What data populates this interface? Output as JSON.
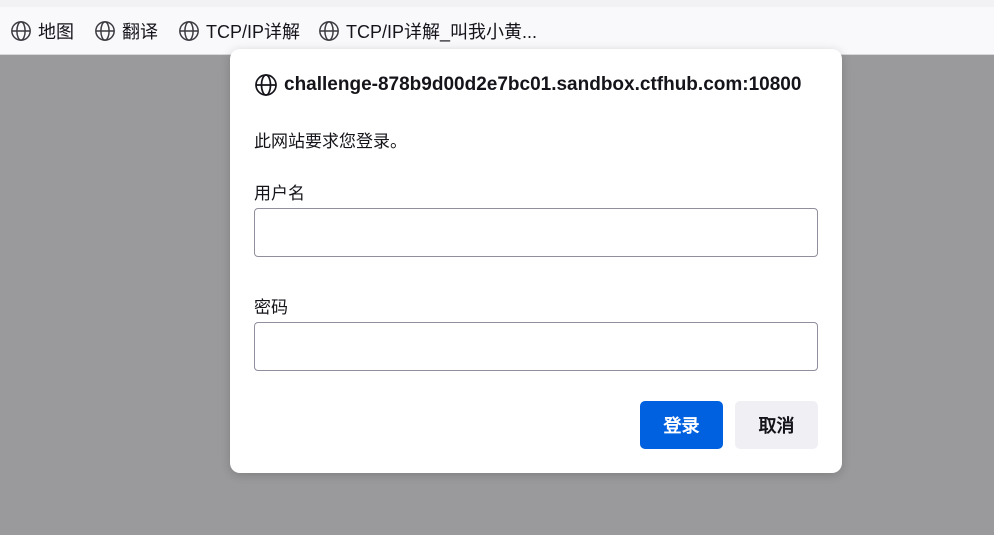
{
  "bookmarks": [
    {
      "label": "地图",
      "icon": "globe-icon"
    },
    {
      "label": "翻译",
      "icon": "globe-icon"
    },
    {
      "label": "TCP/IP详解",
      "icon": "globe-icon"
    },
    {
      "label": "TCP/IP详解_叫我小黄...",
      "icon": "globe-icon"
    }
  ],
  "dialog": {
    "host": "challenge-878b9d00d2e7bc01.sandbox.ctfhub.com:10800",
    "host_icon": "globe-icon",
    "message": "此网站要求您登录。",
    "username_label": "用户名",
    "username_value": "",
    "password_label": "密码",
    "password_value": "",
    "login_button": "登录",
    "cancel_button": "取消"
  },
  "colors": {
    "primary": "#0061e0",
    "overlay": "#9a9a9c",
    "toolbar": "#f9f9fb"
  }
}
